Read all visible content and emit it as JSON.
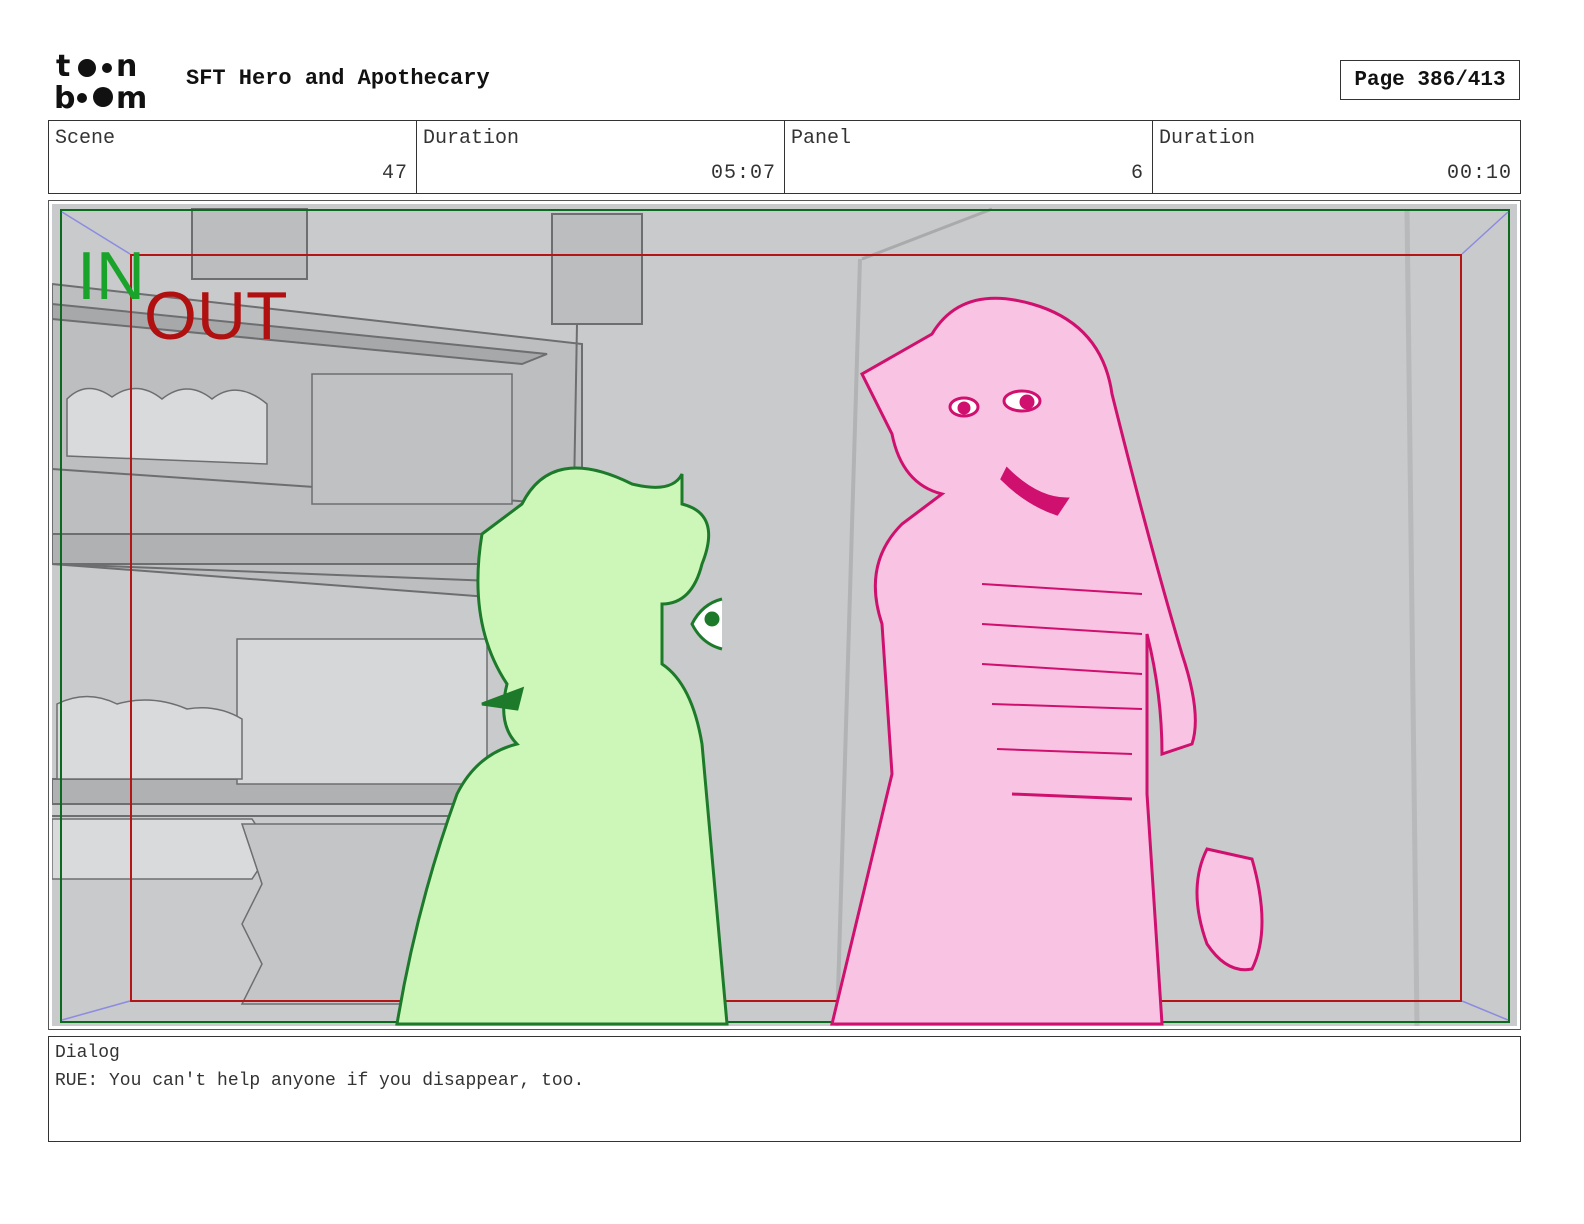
{
  "header": {
    "logo_text": "toon boom",
    "project_title": "SFT Hero and Apothecary",
    "page_label": "Page 386/413"
  },
  "info": {
    "scene_label": "Scene",
    "scene_value": "47",
    "scene_duration_label": "Duration",
    "scene_duration_value": "05:07",
    "panel_label": "Panel",
    "panel_value": "6",
    "panel_duration_label": "Duration",
    "panel_duration_value": "00:10"
  },
  "panel": {
    "in_marker": "IN",
    "out_marker": "OUT",
    "in_color": "#1aa32a",
    "out_color": "#b01010",
    "green_character_color": "#ccf7b8",
    "pink_character_color": "#f9c4e4"
  },
  "dialog": {
    "label": "Dialog",
    "text": "RUE: You can't help anyone if you disappear, too."
  }
}
